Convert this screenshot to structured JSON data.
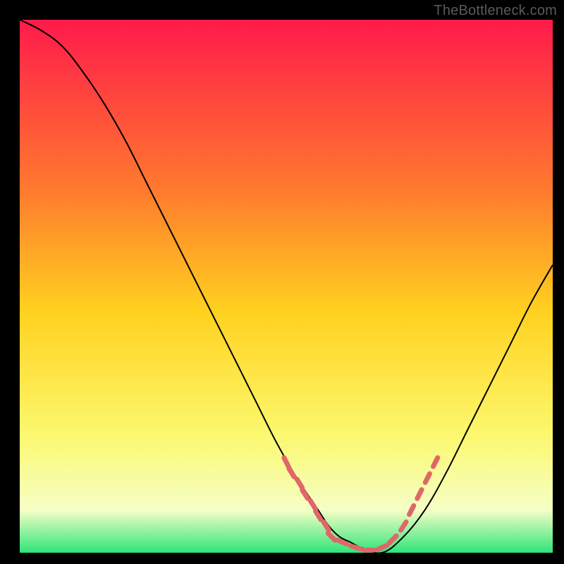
{
  "watermark": "TheBottleneck.com",
  "colors": {
    "background": "#000000",
    "gradient_top": "#ff1a4b",
    "gradient_mid_upper": "#ff7a2e",
    "gradient_mid": "#ffd21f",
    "gradient_lower": "#fcf86f",
    "gradient_pale": "#f5ffc6",
    "gradient_bottom": "#2fe47a",
    "curve": "#000000",
    "marker": "#e06767",
    "watermark": "#5a5a5a"
  },
  "chart_data": {
    "type": "line",
    "title": "",
    "xlabel": "",
    "ylabel": "",
    "xlim": [
      0,
      100
    ],
    "ylim": [
      0,
      100
    ],
    "grid": false,
    "series": [
      {
        "name": "curve",
        "x": [
          0,
          4,
          8,
          12,
          16,
          20,
          24,
          28,
          32,
          36,
          40,
          44,
          48,
          52,
          56,
          58,
          60,
          62,
          64,
          68,
          72,
          76,
          80,
          84,
          88,
          92,
          96,
          100
        ],
        "y": [
          100,
          98,
          95,
          90,
          84,
          77,
          69,
          61,
          53,
          45,
          37,
          29,
          21,
          14,
          8,
          5,
          3,
          2,
          1,
          0,
          3,
          8,
          15,
          23,
          31,
          39,
          47,
          54
        ]
      }
    ],
    "markers": {
      "name": "highlight-dashes",
      "style": "dash",
      "points": [
        {
          "x": 50,
          "y": 17
        },
        {
          "x": 51,
          "y": 15
        },
        {
          "x": 52.5,
          "y": 13
        },
        {
          "x": 53.5,
          "y": 11
        },
        {
          "x": 55,
          "y": 9
        },
        {
          "x": 56,
          "y": 7
        },
        {
          "x": 57.5,
          "y": 5
        },
        {
          "x": 58.5,
          "y": 3
        },
        {
          "x": 60.5,
          "y": 2
        },
        {
          "x": 63,
          "y": 1
        },
        {
          "x": 65.5,
          "y": 0.5
        },
        {
          "x": 68,
          "y": 1
        },
        {
          "x": 70,
          "y": 2.5
        },
        {
          "x": 72,
          "y": 5
        },
        {
          "x": 73.5,
          "y": 8
        },
        {
          "x": 75,
          "y": 11
        },
        {
          "x": 76.5,
          "y": 14
        },
        {
          "x": 78,
          "y": 17
        }
      ]
    }
  }
}
